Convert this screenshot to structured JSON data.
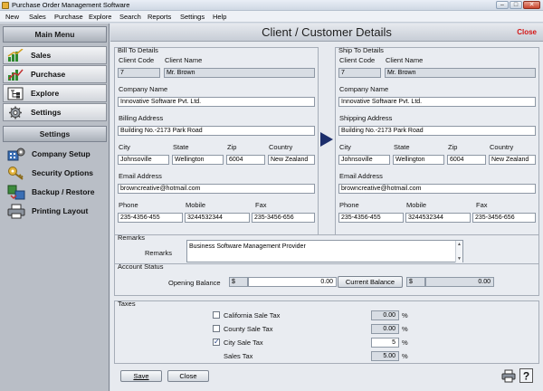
{
  "window": {
    "title": "Purchase Order Management Software"
  },
  "menu": [
    "New",
    "Sales",
    "Purchase",
    "Explore",
    "Search",
    "Reports",
    "Settings",
    "Help"
  ],
  "sidebar": {
    "main_menu_title": "Main Menu",
    "main_items": [
      {
        "label": "Sales",
        "icon": "sales-chart-icon"
      },
      {
        "label": "Purchase",
        "icon": "purchase-chart-icon"
      },
      {
        "label": "Explore",
        "icon": "explore-tree-icon"
      },
      {
        "label": "Settings",
        "icon": "settings-gear-icon"
      }
    ],
    "settings_title": "Settings",
    "settings_items": [
      {
        "label": "Company Setup",
        "icon": "company-setup-icon"
      },
      {
        "label": "Security Options",
        "icon": "security-key-icon"
      },
      {
        "label": "Backup / Restore",
        "icon": "backup-restore-icon"
      },
      {
        "label": "Printing Layout",
        "icon": "printer-icon"
      }
    ]
  },
  "page": {
    "title": "Client / Customer Details",
    "close_label": "Close"
  },
  "bill_to": {
    "group_label": "Bill To Details",
    "client_code_label": "Client Code",
    "client_name_label": "Client Name",
    "client_code": "7",
    "client_name": "Mr. Brown",
    "company_name_label": "Company Name",
    "company_name": "Innovative Software Pvt. Ltd.",
    "address_label": "Billing Address",
    "address": "Building No.-2173 Park Road",
    "city_label": "City",
    "state_label": "State",
    "zip_label": "Zip",
    "country_label": "Country",
    "city": "Johnsoville",
    "state": "Wellington",
    "zip": "6004",
    "country": "New Zealand",
    "email_label": "Email Address",
    "email": "browncreative@hotmail.com",
    "phone_label": "Phone",
    "mobile_label": "Mobile",
    "fax_label": "Fax",
    "phone": "235-4356-455",
    "mobile": "3244532344",
    "fax": "235-3456-656"
  },
  "ship_to": {
    "group_label": "Ship To Details",
    "client_code_label": "Client Code",
    "client_name_label": "Client Name",
    "client_code": "7",
    "client_name": "Mr. Brown",
    "company_name_label": "Company Name",
    "company_name": "Innovative Software Pvt. Ltd.",
    "address_label": "Shipping Address",
    "address": "Building No.-2173 Park Road",
    "city_label": "City",
    "state_label": "State",
    "zip_label": "Zip",
    "country_label": "Country",
    "city": "Johnsoville",
    "state": "Wellington",
    "zip": "6004",
    "country": "New Zealand",
    "email_label": "Email Address",
    "email": "browncreative@hotmail.com",
    "phone_label": "Phone",
    "mobile_label": "Mobile",
    "fax_label": "Fax",
    "phone": "235-4356-455",
    "mobile": "3244532344",
    "fax": "235-3456-656"
  },
  "remarks": {
    "group_label": "Remarks",
    "field_label": "Remarks",
    "value": "Business Software Management Provider"
  },
  "account_status": {
    "group_label": "Account Status",
    "opening_balance_label": "Opening Balance",
    "currency_symbol": "$",
    "opening_balance": "0.00",
    "current_balance_button": "Current Balance",
    "current_balance": "0.00"
  },
  "taxes": {
    "group_label": "Taxes",
    "items": [
      {
        "label": "California Sale Tax",
        "checked": false,
        "value": "0.00",
        "unit": "%"
      },
      {
        "label": "County Sale Tax",
        "checked": false,
        "value": "0.00",
        "unit": "%"
      },
      {
        "label": "City Sale Tax",
        "checked": true,
        "value": "5",
        "unit": "%"
      }
    ],
    "sales_tax_label": "Sales Tax",
    "sales_tax_value": "5.00",
    "sales_tax_unit": "%"
  },
  "footer": {
    "save_label": "Save",
    "close_label": "Close"
  }
}
